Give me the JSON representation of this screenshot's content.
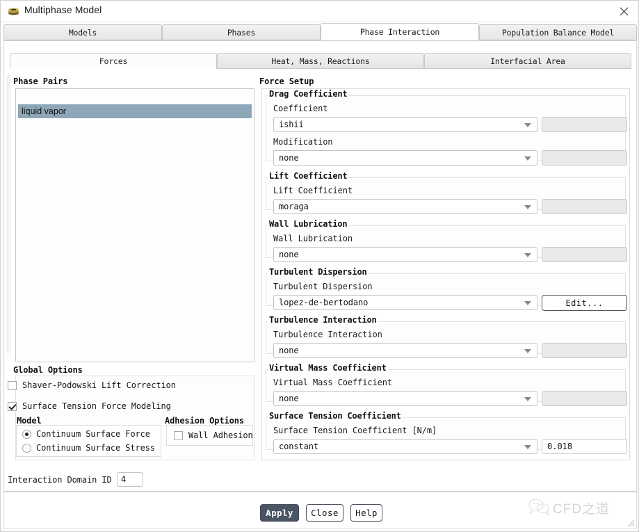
{
  "window": {
    "title": "Multiphase Model",
    "app_icon": "stack-layers-icon",
    "close_icon": "close-icon"
  },
  "tabs": {
    "items": [
      {
        "label": "Models",
        "active": false
      },
      {
        "label": "Phases",
        "active": false
      },
      {
        "label": "Phase Interaction",
        "active": true
      },
      {
        "label": "Population Balance Model",
        "active": false
      }
    ]
  },
  "subtabs": {
    "items": [
      {
        "label": "Forces",
        "active": true
      },
      {
        "label": "Heat, Mass, Reactions",
        "active": false
      },
      {
        "label": "Interfacial Area",
        "active": false
      }
    ]
  },
  "phase_pairs": {
    "title": "Phase Pairs",
    "items": [
      {
        "label": "liquid vapor",
        "selected": true
      }
    ]
  },
  "force_setup": {
    "title": "Force Setup",
    "sections": [
      {
        "title": "Drag Coefficient",
        "rows": [
          {
            "label": "Coefficient",
            "value": "ishii",
            "aux_type": "readonly",
            "aux_value": ""
          },
          {
            "label": "Modification",
            "value": "none",
            "aux_type": "readonly",
            "aux_value": ""
          }
        ]
      },
      {
        "title": "Lift Coefficient",
        "rows": [
          {
            "label": "Lift Coefficient",
            "value": "moraga",
            "aux_type": "readonly",
            "aux_value": ""
          }
        ]
      },
      {
        "title": "Wall Lubrication",
        "rows": [
          {
            "label": "Wall Lubrication",
            "value": "none",
            "aux_type": "readonly",
            "aux_value": ""
          }
        ]
      },
      {
        "title": "Turbulent Dispersion",
        "rows": [
          {
            "label": "Turbulent Dispersion",
            "value": "lopez-de-bertodano",
            "aux_type": "button",
            "aux_value": "Edit..."
          }
        ]
      },
      {
        "title": "Turbulence Interaction",
        "rows": [
          {
            "label": "Turbulence Interaction",
            "value": "none",
            "aux_type": "readonly",
            "aux_value": ""
          }
        ]
      },
      {
        "title": "Virtual Mass Coefficient",
        "rows": [
          {
            "label": "Virtual Mass Coefficient",
            "value": "none",
            "aux_type": "readonly",
            "aux_value": ""
          }
        ]
      },
      {
        "title": "Surface Tension Coefficient",
        "rows": [
          {
            "label": "Surface Tension Coefficient [N/m]",
            "value": "constant",
            "aux_type": "editable",
            "aux_value": "0.018"
          }
        ]
      }
    ]
  },
  "global_options": {
    "title": "Global Options",
    "checkboxes": [
      {
        "label": "Shaver-Podowski Lift Correction",
        "checked": false
      },
      {
        "label": "Surface Tension Force Modeling",
        "checked": true
      }
    ],
    "model": {
      "title": "Model",
      "options": [
        {
          "label": "Continuum Surface Force",
          "selected": true
        },
        {
          "label": "Continuum Surface Stress",
          "selected": false
        }
      ]
    },
    "adhesion": {
      "title": "Adhesion Options",
      "checkbox": {
        "label": "Wall Adhesion",
        "checked": false
      }
    }
  },
  "bottom": {
    "domain_label": "Interaction Domain ID",
    "domain_value": "4",
    "buttons": [
      {
        "label": "Apply",
        "primary": true
      },
      {
        "label": "Close",
        "primary": false
      },
      {
        "label": "Help",
        "primary": false
      }
    ]
  },
  "watermark": {
    "text": "CFD之道",
    "icon": "wechat-icon"
  },
  "colors": {
    "selection": "#8ea7b8",
    "primary_button": "#4a5462",
    "readonly_field": "#eaeaea"
  }
}
